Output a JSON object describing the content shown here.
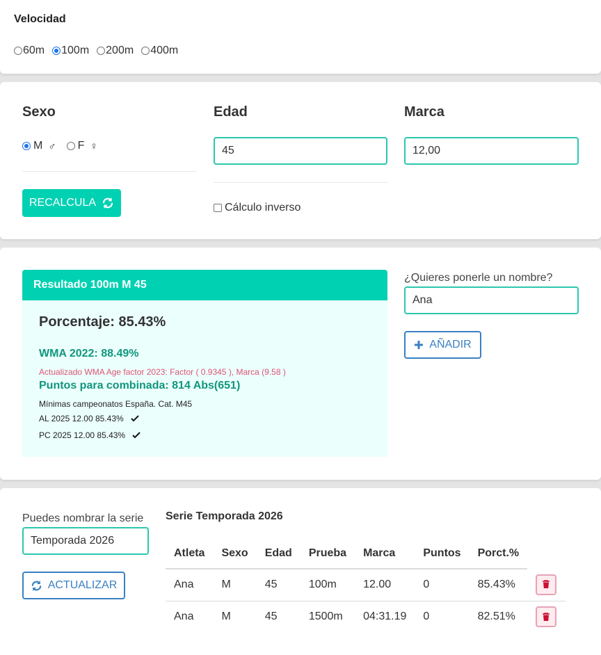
{
  "velocidad": {
    "title": "Velocidad",
    "options": [
      {
        "label": "60m",
        "selected": false
      },
      {
        "label": "100m",
        "selected": true
      },
      {
        "label": "200m",
        "selected": false
      },
      {
        "label": "400m",
        "selected": false
      }
    ]
  },
  "form": {
    "sexo_label": "Sexo",
    "sexo_m": "M",
    "sexo_m_symbol": "♂",
    "sexo_f": "F",
    "sexo_f_symbol": "♀",
    "edad_label": "Edad",
    "edad_value": "45",
    "marca_label": "Marca",
    "marca_value": "12,00",
    "recalcula_label": "RECALCULA",
    "inverso_label": "Cálculo inverso"
  },
  "resultado": {
    "header": "Resultado 100m M 45",
    "porcentaje": "Porcentaje: 85.43%",
    "wma": "WMA 2022: 88.49%",
    "actualizado": "Actualizado WMA Age factor 2023: Factor ( 0.9345 ), Marca (9.58 )",
    "puntos": "Puntos para combinada: 814 Abs(651)",
    "minimas": "Mínimas campeonatos España. Cat. M45",
    "al": "AL 2025 12.00 85.43%",
    "pc": "PC 2025 12.00 85.43%"
  },
  "nombre": {
    "label": "¿Quieres ponerle un nombre?",
    "value": "Ana",
    "add_label": "AÑADIR"
  },
  "serie": {
    "label": "Puedes nombrar la serie",
    "value": "Temporada 2026",
    "actualizar_label": "ACTUALIZAR",
    "title": "Serie Temporada 2026",
    "columns": [
      "Atleta",
      "Sexo",
      "Edad",
      "Prueba",
      "Marca",
      "Puntos",
      "Porct.%"
    ],
    "rows": [
      [
        "Ana",
        "M",
        "45",
        "100m",
        "12.00",
        "0",
        "85.43%"
      ],
      [
        "Ana",
        "M",
        "45",
        "1500m",
        "04:31.19",
        "0",
        "82.51%"
      ]
    ]
  },
  "colors": {
    "primary": "#00d1b2",
    "link": "#3a80c2",
    "danger": "#cc0f35",
    "accent_text": "#11967d",
    "note_text": "#e05375"
  }
}
